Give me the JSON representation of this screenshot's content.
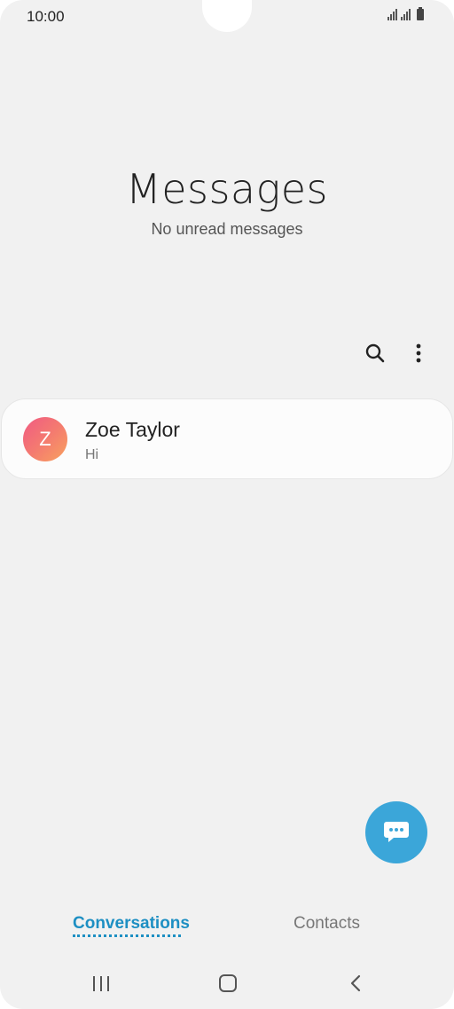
{
  "status_bar": {
    "time": "10:00",
    "icons": [
      "signal-icon",
      "signal-icon",
      "battery-icon"
    ]
  },
  "header": {
    "title": "Messages",
    "subtitle": "No unread messages"
  },
  "toolbar": {
    "search_icon": "search-icon",
    "more_icon": "more-vertical-icon"
  },
  "conversations": [
    {
      "avatar_letter": "Z",
      "name": "Zoe Taylor",
      "preview": "Hi"
    }
  ],
  "fab": {
    "icon": "compose-message-icon",
    "color": "#3ba6d9"
  },
  "tabs": [
    {
      "label": "Conversations",
      "active": true
    },
    {
      "label": "Contacts",
      "active": false
    }
  ],
  "colors": {
    "accent": "#1d8fc3",
    "background": "#f1f1f1",
    "avatar_gradient": [
      "#f05a83",
      "#f8a25e"
    ]
  },
  "nav_bar": {
    "icons": [
      "recents-icon",
      "home-icon",
      "back-icon"
    ]
  }
}
